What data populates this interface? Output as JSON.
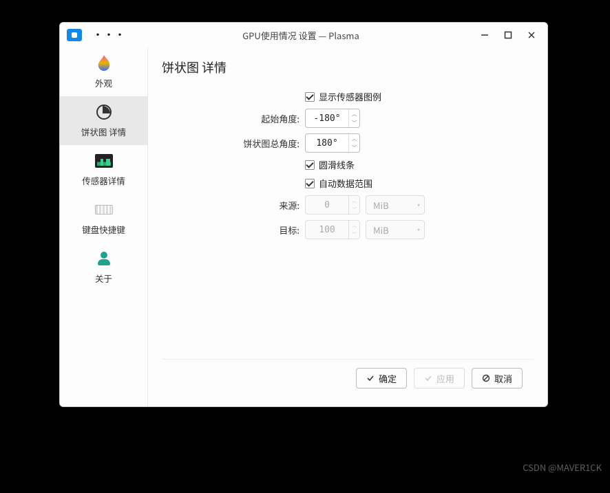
{
  "window": {
    "title": "GPU使用情况 设置 — Plasma",
    "overflow": "•••"
  },
  "sidebar": {
    "items": [
      {
        "label": "外观"
      },
      {
        "label": "饼状图 详情"
      },
      {
        "label": "传感器详情"
      },
      {
        "label": "键盘快捷键"
      },
      {
        "label": "关于"
      }
    ]
  },
  "page": {
    "title": "饼状图 详情"
  },
  "form": {
    "show_legend_label": "显示传感器图例",
    "show_legend_checked": true,
    "start_angle_label": "起始角度:",
    "start_angle_value": "-180°",
    "total_angle_label": "饼状图总角度:",
    "total_angle_value": "180°",
    "smooth_lines_label": "圆滑线条",
    "smooth_lines_checked": true,
    "auto_range_label": "自动数据范围",
    "auto_range_checked": true,
    "from_label": "来源:",
    "from_value": "0",
    "from_unit": "MiB",
    "to_label": "目标:",
    "to_value": "100",
    "to_unit": "MiB"
  },
  "buttons": {
    "ok": "确定",
    "apply": "应用",
    "cancel": "取消"
  },
  "watermark": "CSDN @MAVER1CK"
}
